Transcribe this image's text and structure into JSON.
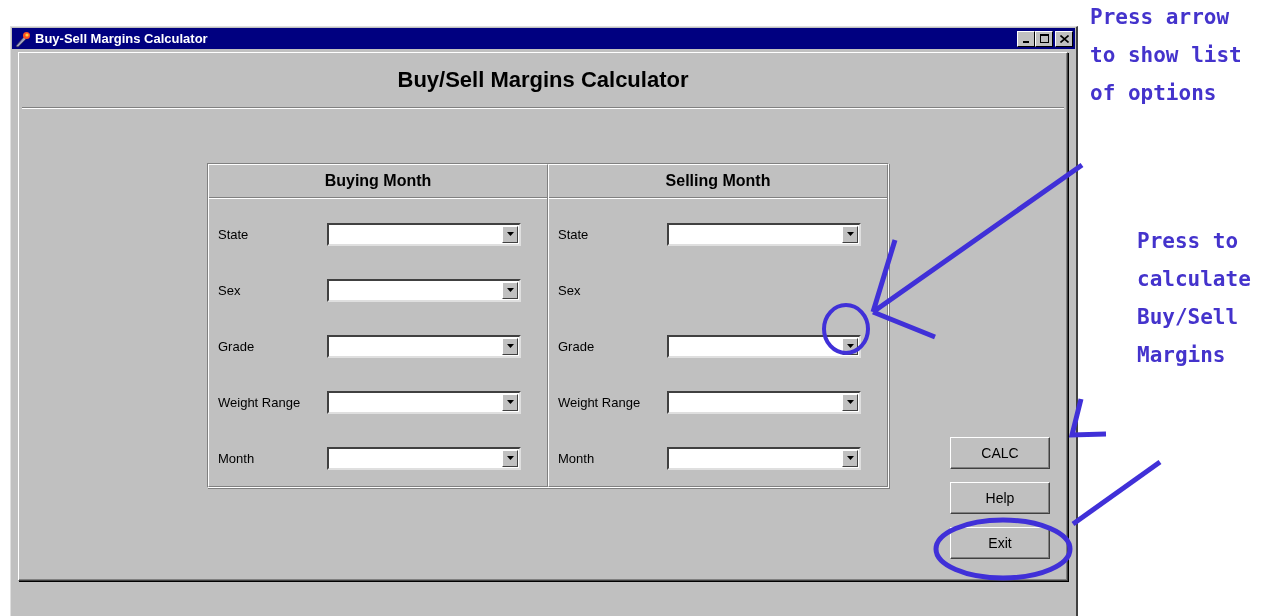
{
  "window": {
    "title": "Buy-Sell Margins Calculator"
  },
  "heading": "Buy/Sell Margins Calculator",
  "sections": [
    {
      "title": "Buying Month",
      "fields": [
        {
          "label": "State",
          "kind": "dropdown"
        },
        {
          "label": "Sex",
          "kind": "dropdown"
        },
        {
          "label": "Grade",
          "kind": "dropdown"
        },
        {
          "label": "Weight Range",
          "kind": "dropdown"
        },
        {
          "label": "Month",
          "kind": "dropdown"
        }
      ]
    },
    {
      "title": "Selling Month",
      "fields": [
        {
          "label": "State",
          "kind": "dropdown"
        },
        {
          "label": "Sex",
          "kind": "label"
        },
        {
          "label": "Grade",
          "kind": "dropdown"
        },
        {
          "label": "Weight Range",
          "kind": "dropdown"
        },
        {
          "label": "Month",
          "kind": "dropdown"
        }
      ]
    }
  ],
  "buttons": [
    "CALC",
    "Help",
    "Exit"
  ],
  "notes": [
    "Press arrow to show list of options",
    "Press to calculate Buy/Sell Margins"
  ]
}
